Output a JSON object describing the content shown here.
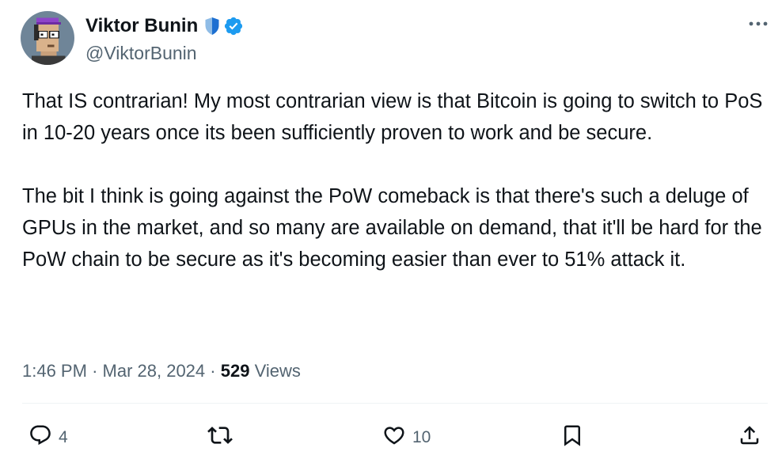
{
  "author": {
    "name": "Viktor Bunin",
    "handle": "@ViktorBunin"
  },
  "tweet": {
    "paragraphs": [
      "That IS contrarian! My most contrarian view is that Bitcoin is going to switch to PoS in 10-20 years once its been sufficiently proven to work and be secure.",
      "The bit I think is going against the PoW comeback is that there's such a deluge of GPUs in the market, and so many are available on demand, that it'll be hard for the PoW chain to be secure as it's becoming easier than ever to 51% attack it."
    ]
  },
  "meta": {
    "time": "1:46 PM",
    "separator": "·",
    "date": "Mar 28, 2024",
    "views_count": "529",
    "views_label": "Views"
  },
  "actions": {
    "replies": "4",
    "likes": "10"
  },
  "colors": {
    "text": "#0f1419",
    "secondary": "#536471",
    "verified_blue": "#1d9bf0",
    "divider": "#eff3f4"
  }
}
